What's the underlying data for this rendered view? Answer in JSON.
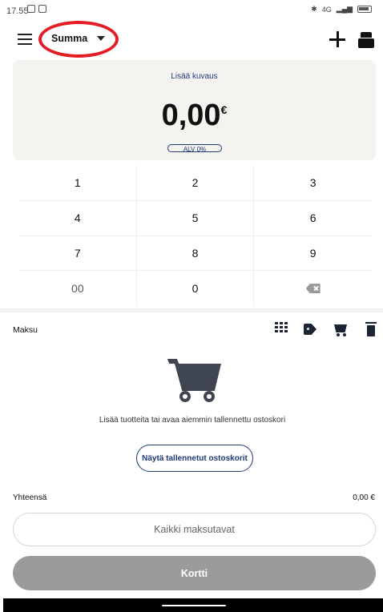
{
  "status_bar": {
    "time": "17.55",
    "network": "4G"
  },
  "header": {
    "mode_label": "Summa"
  },
  "amount_panel": {
    "description_link": "Lisää kuvaus",
    "amount": "0,00",
    "currency": "€",
    "vat_label": "ALV 0%"
  },
  "keypad": {
    "keys": [
      "1",
      "2",
      "3",
      "4",
      "5",
      "6",
      "7",
      "8",
      "9",
      "00",
      "0"
    ]
  },
  "payment": {
    "section_label": "Maksu",
    "empty_message": "Lisää tuotteita tai avaa aiemmin tallennettu ostoskori",
    "show_saved_button": "Näytä tallennetut ostoskorit",
    "total_label": "Yhteensä",
    "total_value": "0,00 €",
    "all_methods_button": "Kaikki maksutavat",
    "card_button": "Kortti"
  },
  "colors": {
    "accent": "#1f3a77",
    "highlight": "#e41c23",
    "card_button": "#9b9b9b",
    "panel": "#f4f3ef"
  }
}
